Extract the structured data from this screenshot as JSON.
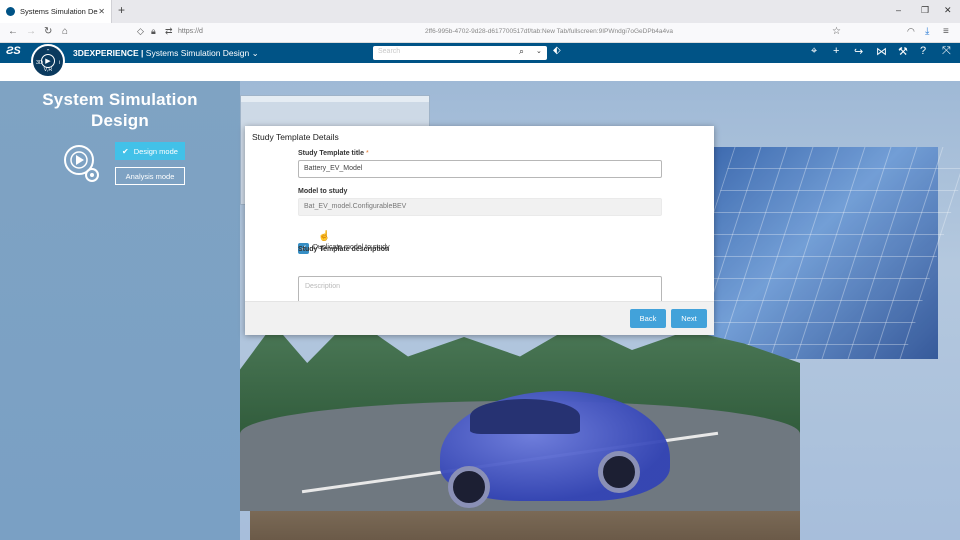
{
  "browser": {
    "tab_title": "Systems Simulation Design",
    "tab_close": "✕",
    "new_tab": "+",
    "url": "https://d",
    "url_center": "2ff6-995b-4702-9d28-d617700517df/tab:New Tab/fullscreen:9IPWndgi7oGeDPb4a4va"
  },
  "header": {
    "brand_prefix": "3DEXPERIENCE |",
    "app_name": "Systems Simulation Design",
    "search_placeholder": "Search"
  },
  "left_panel": {
    "title": "System Simulation Design",
    "design_mode": "Design mode",
    "analysis_mode": "Analysis mode"
  },
  "modal": {
    "title": "Study Template Details",
    "template_title_label": "Study Template title",
    "required_mark": "*",
    "template_title_value": "Battery_EV_Model",
    "model_label": "Model to study",
    "model_value": "Bat_EV_model.ConfigurableBEV",
    "duplicate_label": "Duplicate model to study",
    "duplicate_checked": true,
    "description_label": "Study Template description",
    "description_placeholder": "Description",
    "back_label": "Back",
    "next_label": "Next"
  },
  "colors": {
    "header_bg": "#005386",
    "accent": "#42a2da",
    "mode_active": "#42c1e8"
  }
}
